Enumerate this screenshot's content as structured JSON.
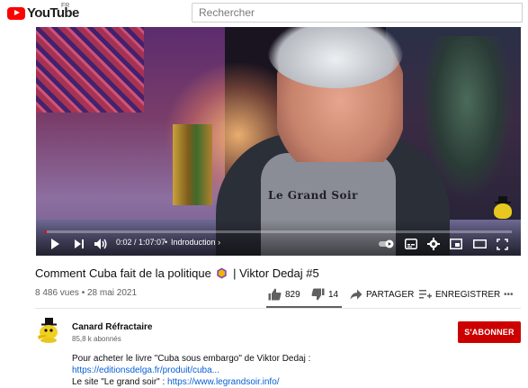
{
  "masthead": {
    "logo_text": "YouTube",
    "country_code": "FR",
    "search_placeholder": "Rechercher"
  },
  "player": {
    "current_time": "0:02",
    "duration": "1:07:07",
    "time_display": "0:02 / 1:07:07",
    "chapter": "Indroduction",
    "progress_fraction": 0.0005,
    "tshirt_text": "Le Grand Soir",
    "icons": [
      "play-icon",
      "next-icon",
      "volume-icon",
      "autoplay-toggle-icon",
      "subtitles-icon",
      "settings-icon",
      "miniplayer-icon",
      "theater-icon",
      "fullscreen-icon"
    ]
  },
  "video": {
    "title_before": "Comment Cuba fait de la politique",
    "title_after": "| Viktor Dedaj #5",
    "views": "8 486 vues",
    "date": "28 mai 2021",
    "meta": "8 486 vues • 28 mai 2021",
    "likes": "829",
    "dislikes": "14",
    "share_label": "PARTAGER",
    "save_label": "ENREGISTRER",
    "more_label": "•••"
  },
  "channel": {
    "name": "Canard Réfractaire",
    "subscribers": "85,8 k abonnés",
    "subscribe_label": "S'ABONNER"
  },
  "description": {
    "line1": "Pour acheter le livre \"Cuba sous embargo\" de Viktor Dedaj :",
    "link1": "https://editionsdelga.fr/produit/cuba...",
    "line3_prefix": "Le site \"Le grand soir\" : ",
    "link2": "https://www.legrandsoir.info/"
  },
  "colors": {
    "brand_red": "#ff0000",
    "subscribe_red": "#cc0000",
    "link_blue": "#065fd4",
    "secondary_text": "#606060"
  }
}
